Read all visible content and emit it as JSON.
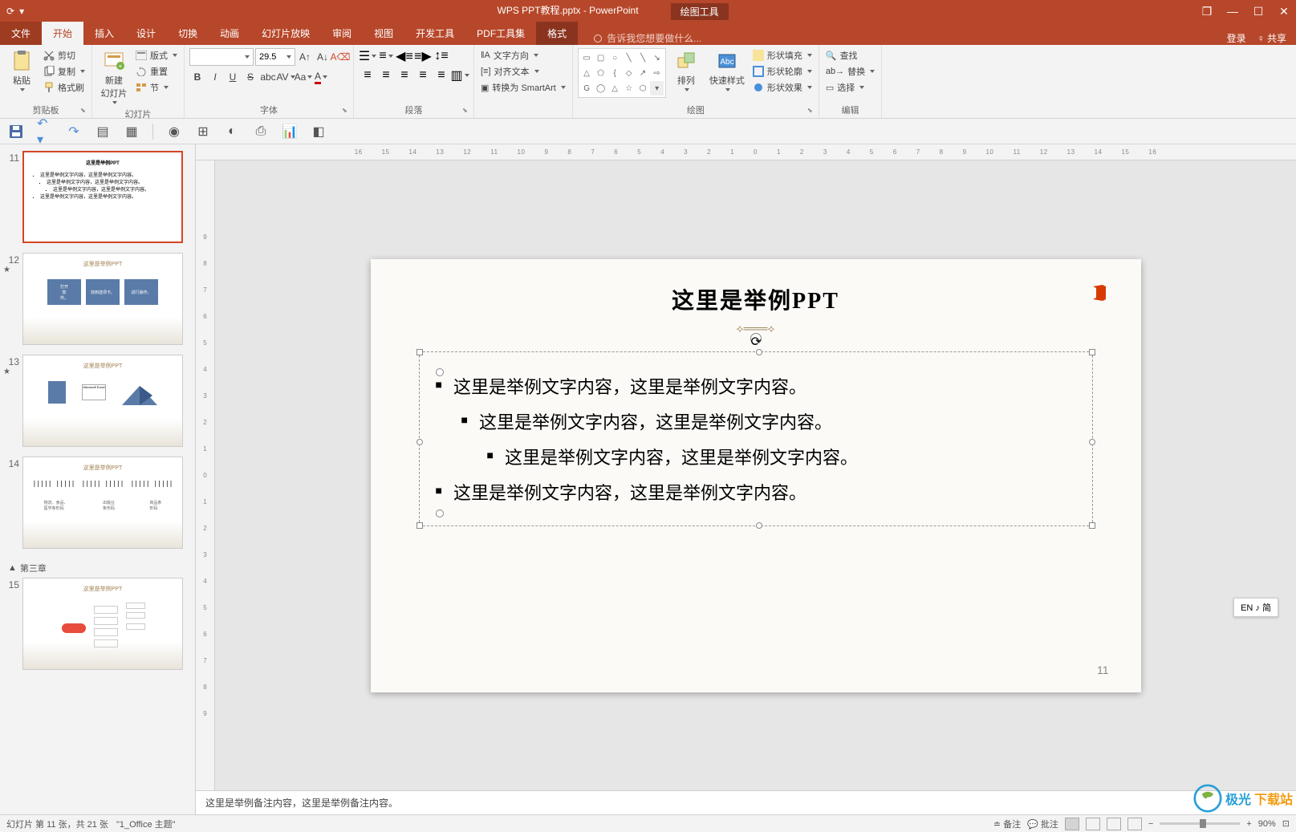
{
  "titlebar": {
    "filename": "WPS PPT教程.pptx - PowerPoint",
    "context_tool": "绘图工具"
  },
  "window_buttons": {
    "restore": "❐",
    "minimize": "—",
    "maximize": "☐",
    "close": "✕"
  },
  "menubar": {
    "file": "文件",
    "tabs": [
      "开始",
      "插入",
      "设计",
      "切换",
      "动画",
      "幻灯片放映",
      "审阅",
      "视图",
      "开发工具",
      "PDF工具集",
      "格式"
    ],
    "active_index": 0,
    "tell_me": "告诉我您想要做什么...",
    "login": "登录",
    "share": "共享"
  },
  "ribbon": {
    "clipboard": {
      "label": "剪贴板",
      "paste": "粘贴",
      "cut": "剪切",
      "copy": "复制",
      "format_painter": "格式刷"
    },
    "slides": {
      "label": "幻灯片",
      "new_slide": "新建\n幻灯片",
      "layout": "版式",
      "reset": "重置",
      "section": "节"
    },
    "font": {
      "label": "字体",
      "name": "",
      "size": "29.5",
      "bold": "B",
      "italic": "I",
      "underline": "U",
      "strike": "S",
      "shadow": "S",
      "spacing": "AV",
      "case": "Aa",
      "clear": "A"
    },
    "paragraph": {
      "label": "段落"
    },
    "text_tools": {
      "direction": "文字方向",
      "align": "对齐文本",
      "smartart": "转换为 SmartArt"
    },
    "drawing": {
      "label": "绘图",
      "arrange": "排列",
      "quick_styles": "快速样式",
      "fill": "形状填充",
      "outline": "形状轮廓",
      "effects": "形状效果"
    },
    "editing": {
      "label": "编辑",
      "find": "查找",
      "replace": "替换",
      "select": "选择"
    }
  },
  "thumbnails": {
    "current": 11,
    "items": [
      11,
      12,
      13,
      14,
      15
    ],
    "section_label": "第三章"
  },
  "slide": {
    "title": "这里是举例PPT",
    "bullets": [
      {
        "text": "这里是举例文字内容，这里是举例文字内容。",
        "indent": 0
      },
      {
        "text": "这里是举例文字内容，这里是举例文字内容。",
        "indent": 1
      },
      {
        "text": "这里是举例文字内容，这里是举例文字内容。",
        "indent": 2
      },
      {
        "text": "这里是举例文字内容，这里是举例文字内容。",
        "indent": 0
      }
    ],
    "page_num": "11"
  },
  "ruler_h": [
    "16",
    "15",
    "14",
    "13",
    "12",
    "11",
    "10",
    "9",
    "8",
    "7",
    "6",
    "5",
    "4",
    "3",
    "2",
    "1",
    "0",
    "1",
    "2",
    "3",
    "4",
    "5",
    "6",
    "7",
    "8",
    "9",
    "10",
    "11",
    "12",
    "13",
    "14",
    "15",
    "16"
  ],
  "ruler_v": [
    "9",
    "8",
    "7",
    "6",
    "5",
    "4",
    "3",
    "2",
    "1",
    "0",
    "1",
    "2",
    "3",
    "4",
    "5",
    "6",
    "7",
    "8",
    "9"
  ],
  "notes": "这里是举例备注内容，这里是举例备注内容。",
  "statusbar": {
    "slide_info": "幻灯片 第 11 张，共 21 张",
    "theme": "\"1_Office 主题\"",
    "notes_btn": "备注",
    "comments_btn": "批注",
    "zoom": "90%"
  },
  "ime": "EN ♪ 简",
  "watermark": {
    "t1": "极光",
    "t2": "下载站"
  }
}
